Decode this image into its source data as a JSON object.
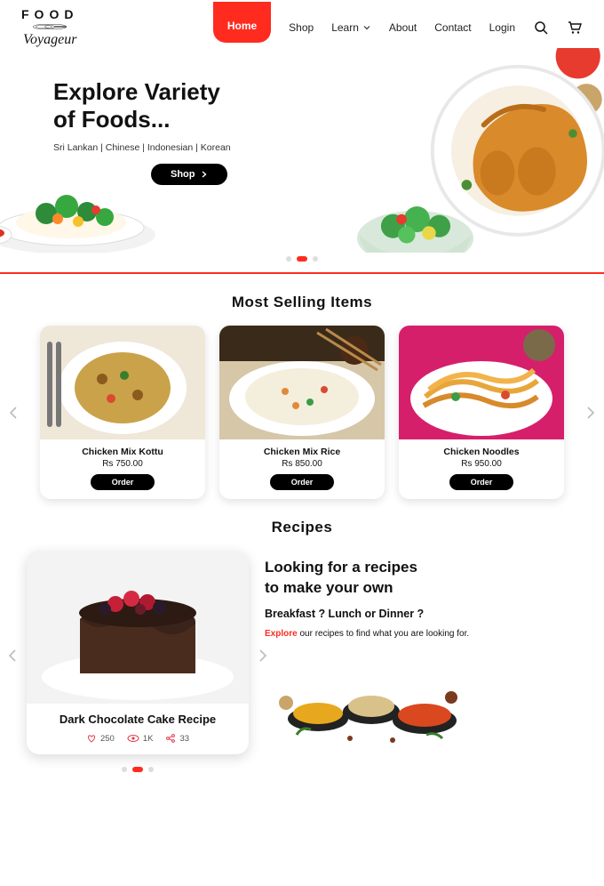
{
  "brand": {
    "top": "FOOD",
    "bottom": "Voyageur"
  },
  "nav": {
    "items": [
      {
        "label": "Home",
        "active": true
      },
      {
        "label": "Shop"
      },
      {
        "label": "Learn"
      },
      {
        "label": "About"
      },
      {
        "label": "Contact"
      },
      {
        "label": "Login"
      }
    ]
  },
  "hero": {
    "title_line1": "Explore Variety",
    "title_line2": "of Foods...",
    "subtitle": "Sri Lankan | Chinese | Indonesian | Korean",
    "shop_button": "Shop",
    "carousel_active": 1,
    "carousel_count": 3
  },
  "sections": {
    "most_selling": "Most Selling Items",
    "recipes": "Recipes"
  },
  "products": [
    {
      "name": "Chicken Mix Kottu",
      "price": "Rs 750.00",
      "order": "Order"
    },
    {
      "name": "Chicken Mix Rice",
      "price": "Rs 850.00",
      "order": "Order"
    },
    {
      "name": "Chicken Noodles",
      "price": "Rs 950.00",
      "order": "Order"
    }
  ],
  "recipe": {
    "title": "Dark Chocolate Cake Recipe",
    "likes": "250",
    "views": "1K",
    "shares": "33",
    "carousel_active": 1,
    "carousel_count": 3
  },
  "recipes_promo": {
    "heading_line1": "Looking for a recipes",
    "heading_line2": "to make your own",
    "subheading": "Breakfast ? Lunch or Dinner ?",
    "explore_word": "Explore",
    "desc_rest": " our recipes to find what you are looking for."
  },
  "colors": {
    "accent": "#ff2b1f"
  }
}
